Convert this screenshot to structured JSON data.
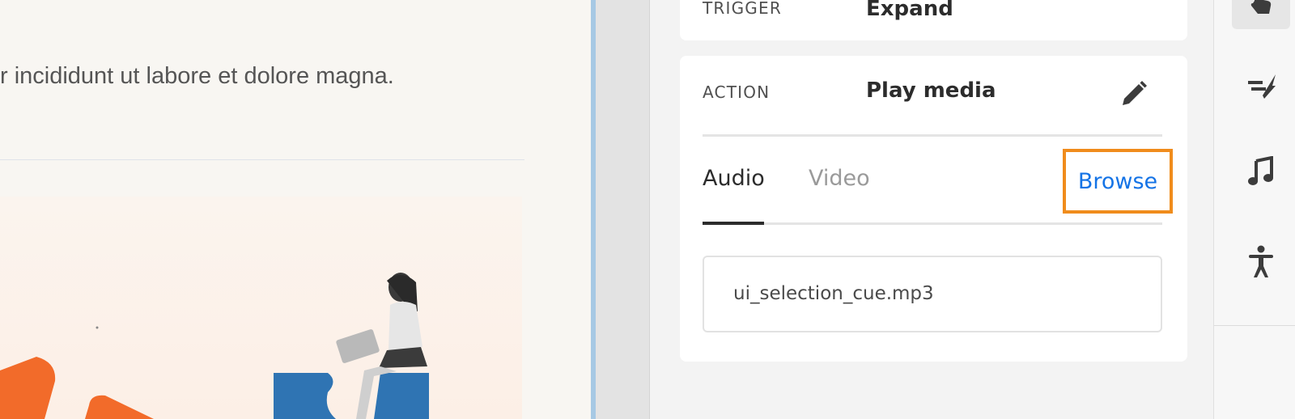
{
  "canvas": {
    "body_text": "r incididunt ut labore et dolore magna."
  },
  "panel": {
    "trigger": {
      "label": "TRIGGER",
      "value": "Expand"
    },
    "action": {
      "label": "ACTION",
      "value": "Play media",
      "edit_icon": "pencil-icon",
      "tabs": [
        {
          "label": "Audio",
          "selected": true
        },
        {
          "label": "Video",
          "selected": false
        }
      ],
      "browse_label": "Browse",
      "file_value": "ui_selection_cue.mp3"
    }
  },
  "rail": {
    "icons": [
      "hand-pointer-icon",
      "motion-icon",
      "music-note-icon",
      "accessibility-icon"
    ]
  },
  "colors": {
    "accent_blue": "#1473e6",
    "highlight_orange": "#f08c1c",
    "canvas_edge": "#a7c9e4",
    "illustration_orange": "#f26b2a",
    "illustration_blue": "#2f74b3"
  }
}
